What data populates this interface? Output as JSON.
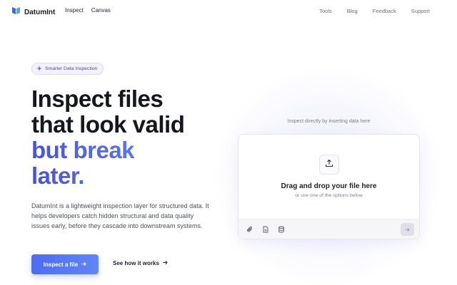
{
  "header": {
    "brand": "DatumInt",
    "nav_left": [
      "Inspect",
      "Canvas"
    ],
    "nav_right": [
      "Tools",
      "Blog",
      "Feedback",
      "Support"
    ]
  },
  "hero": {
    "badge": "Smarter Data Inspection",
    "headline_line1": "Inspect files",
    "headline_line2": "that look valid",
    "headline_line3": "but break",
    "headline_line4": "later.",
    "description": "DatumInt is a lightweight inspection layer for structured data. It helps developers catch hidden structural and data quality issues early, before they cascade into downstream systems.",
    "primary_cta": "Inspect a file",
    "secondary_cta": "See how it works"
  },
  "uploader": {
    "label": "Inspect directly by inserting data here",
    "title": "Drag and drop your file here",
    "subtitle": "or use one of the options below"
  },
  "colors": {
    "accent": "#4d6cf0",
    "headline_gradient_start": "#4a52d6",
    "headline_gradient_end": "#6f94f5"
  },
  "icons": {
    "brand": "book-logo-icon",
    "badge": "sparkle-icon",
    "upload": "upload-icon",
    "attach": "paperclip-icon",
    "document": "document-icon",
    "database": "database-icon",
    "send": "arrow-right-icon"
  }
}
